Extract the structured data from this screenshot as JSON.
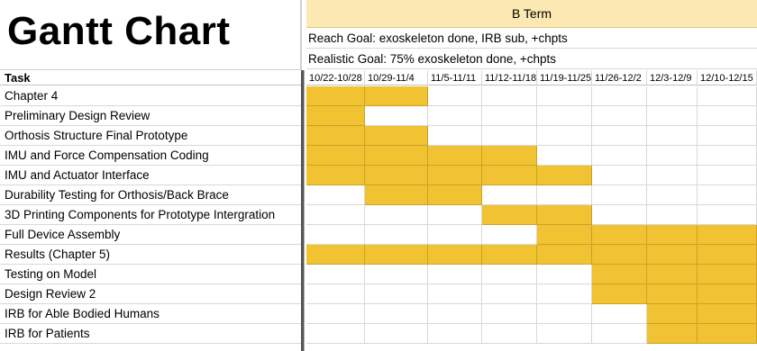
{
  "title": "Gantt Chart",
  "term_label": "B Term",
  "reach_goal": "Reach Goal: exoskeleton done, IRB sub, +chpts",
  "realistic_goal": "Realistic Goal: 75% exoskeleton done, +chpts",
  "task_header": "Task",
  "colors": {
    "filled": "#f1c232",
    "term_header": "#fce8b2"
  },
  "weeks": [
    "10/22-10/28",
    "10/29-11/4",
    "11/5-11/11",
    "11/12-11/18",
    "11/19-11/25",
    "11/26-12/2",
    "12/3-12/9",
    "12/10-12/15"
  ],
  "tasks": [
    {
      "name": "Chapter 4",
      "weeks_active": [
        0,
        1
      ]
    },
    {
      "name": "Preliminary Design Review",
      "weeks_active": [
        0
      ]
    },
    {
      "name": "Orthosis Structure Final Prototype",
      "weeks_active": [
        0,
        1
      ]
    },
    {
      "name": "IMU and Force Compensation Coding",
      "weeks_active": [
        0,
        1,
        2,
        3
      ]
    },
    {
      "name": "IMU and Actuator Interface",
      "weeks_active": [
        0,
        1,
        2,
        3,
        4
      ]
    },
    {
      "name": "Durability Testing for Orthosis/Back Brace",
      "weeks_active": [
        1,
        2
      ]
    },
    {
      "name": "3D Printing Components for Prototype Intergration",
      "weeks_active": [
        3,
        4
      ]
    },
    {
      "name": "Full Device Assembly",
      "weeks_active": [
        4,
        5,
        6,
        7
      ]
    },
    {
      "name": "Results (Chapter 5)",
      "weeks_active": [
        0,
        1,
        2,
        3,
        4,
        5,
        6,
        7
      ]
    },
    {
      "name": "Testing on Model",
      "weeks_active": [
        5,
        6,
        7
      ]
    },
    {
      "name": "Design Review 2",
      "weeks_active": [
        5,
        6,
        7
      ]
    },
    {
      "name": "IRB for Able Bodied Humans",
      "weeks_active": [
        6,
        7
      ]
    },
    {
      "name": "IRB for Patients",
      "weeks_active": [
        6,
        7
      ]
    }
  ]
}
